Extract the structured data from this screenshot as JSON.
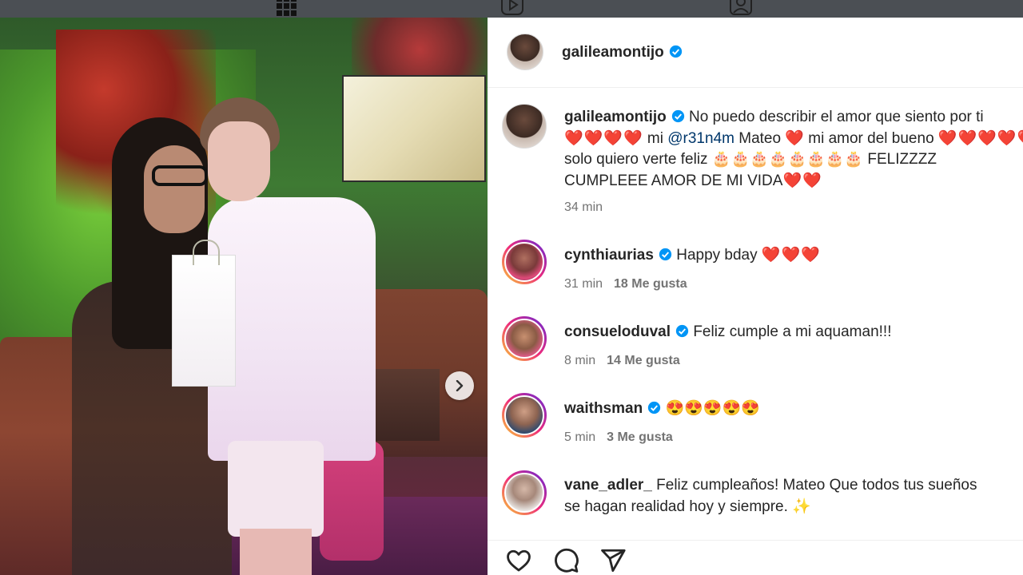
{
  "topbar": {
    "icons": [
      "grid-icon",
      "reels-icon",
      "profile-tagged-icon"
    ]
  },
  "post": {
    "author": "galileamontijo",
    "carousel_next_icon": "chevron-right-icon"
  },
  "caption": {
    "username": "galileamontijo",
    "line1": "No puedo describir el amor que siento por ti",
    "line2_hearts": "❤️❤️❤️❤️",
    "line2_mi": " mi ",
    "mention": "@r31n4m",
    "line2_rest": " Mateo ❤️ mi amor del bueno ",
    "line2_hearts2": "❤️❤️❤️❤️❤️",
    "line3_a": "solo quiero verte feliz ",
    "cakes": "🎂🎂🎂🎂🎂🎂🎂🎂",
    "line3_b": " FELIZZZZ",
    "line4": "CUMPLEEE AMOR DE MI VIDA",
    "line4_hearts": "❤️❤️",
    "time": "34 min"
  },
  "comments": [
    {
      "username": "cynthiaurias",
      "verified": true,
      "text": "Happy bday ",
      "emoji": "❤️❤️❤️",
      "time": "31 min",
      "likes": "18 Me gusta"
    },
    {
      "username": "consueloduval",
      "verified": true,
      "text": "Feliz cumple a mi aquaman!!!",
      "emoji": "",
      "time": "8 min",
      "likes": "14 Me gusta"
    },
    {
      "username": "waithsman",
      "verified": true,
      "text": "",
      "emoji": "😍😍😍😍😍",
      "time": "5 min",
      "likes": "3 Me gusta"
    },
    {
      "username": "vane_adler_",
      "verified": false,
      "text": "Feliz cumpleaños! Mateo Que todos tus sueños",
      "text2": "se hagan realidad hoy y siempre. ",
      "emoji": "✨",
      "time": "",
      "likes": ""
    }
  ],
  "actions": {
    "icons": [
      "like-icon",
      "comment-icon",
      "share-icon"
    ]
  },
  "colors": {
    "verified": "#0095f6",
    "link": "#00376b",
    "meta": "#737373",
    "heart": "#e0245e"
  }
}
